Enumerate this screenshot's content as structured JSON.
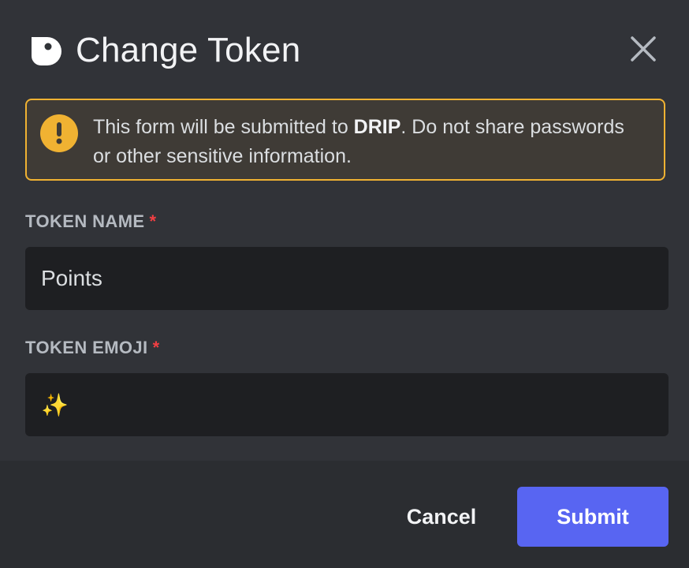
{
  "modal": {
    "title": "Change Token",
    "close_icon": "close-icon",
    "app_icon": "drip-logo-icon"
  },
  "notice": {
    "icon": "warning-icon",
    "text_before": "This form will be submitted to ",
    "app_name": "DRIP",
    "text_after": ". Do not share passwords or other sensitive information."
  },
  "fields": {
    "token_name": {
      "label": "TOKEN NAME",
      "required_marker": "*",
      "value": "Points"
    },
    "token_emoji": {
      "label": "TOKEN EMOJI",
      "required_marker": "*",
      "value": "✨"
    }
  },
  "footer": {
    "cancel_label": "Cancel",
    "submit_label": "Submit"
  },
  "colors": {
    "background": "#313338",
    "footer": "#2b2d31",
    "input": "#1e1f22",
    "warning": "#f0b232",
    "required": "#f23f43",
    "primary": "#5865f2"
  }
}
